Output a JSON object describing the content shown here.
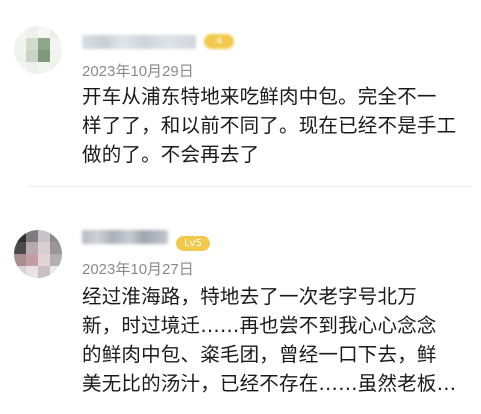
{
  "reviews": [
    {
      "level_badge": "4",
      "date": "2023年10月29日",
      "comment": "开车从浦东特地来吃鲜肉中包。完全不一\n样了了，和以前不同了。现在已经不是手工\n做的了。不会再去了",
      "avatar_colors": [
        "#f4f6f3",
        "#eef1ec",
        "#f6f7f5",
        "#e9ede7",
        "#f2f4f0",
        "#d2dccf",
        "#8fa88a",
        "#f3f5f1",
        "#eff2ed",
        "#c9d4c6",
        "#7f9a7b",
        "#f1f3ef",
        "#f5f6f4",
        "#edf0eb",
        "#f3f5f2",
        "#eef1ec"
      ]
    },
    {
      "level_badge": "Lv5",
      "date": "2023年10月27日",
      "comment": "经过淮海路，特地去了一次老字号北万\n新，时过境迁……再也尝不到我心心念念\n的鲜肉中包、粢毛团，曾经一口下去，鲜\n美无比的汤汁，已经不存在……虽然老板…",
      "avatar_colors": [
        "#2f2f32",
        "#7b7b80",
        "#c7c5c9",
        "#8d8b90",
        "#4a4a4e",
        "#b8a9ab",
        "#d7cfd1",
        "#9a9599",
        "#a58f93",
        "#c39ea5",
        "#e2d3d6",
        "#b3aeb2",
        "#d9d3d5",
        "#e8e2e4",
        "#c7c1c3",
        "#ecebed"
      ]
    }
  ]
}
